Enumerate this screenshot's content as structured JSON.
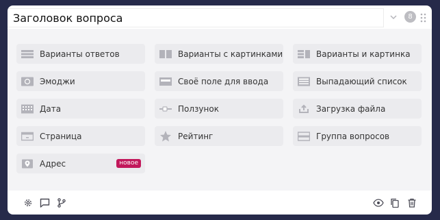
{
  "header": {
    "title": "Заголовок вопроса",
    "badge": "8"
  },
  "tiles": [
    {
      "label": "Варианты ответов",
      "icon": "list-icon"
    },
    {
      "label": "Варианты с картинками",
      "icon": "image-choices-icon"
    },
    {
      "label": "Варианты и картинка",
      "icon": "choices-and-image-icon"
    },
    {
      "label": "Эмоджи",
      "icon": "emoji-icon"
    },
    {
      "label": "Своё поле для ввода",
      "icon": "text-field-icon"
    },
    {
      "label": "Выпадающий список",
      "icon": "dropdown-list-icon"
    },
    {
      "label": "Дата",
      "icon": "calendar-icon"
    },
    {
      "label": "Ползунок",
      "icon": "slider-icon"
    },
    {
      "label": "Загрузка файла",
      "icon": "upload-icon"
    },
    {
      "label": "Страница",
      "icon": "page-icon"
    },
    {
      "label": "Рейтинг",
      "icon": "star-icon"
    },
    {
      "label": "Группа вопросов",
      "icon": "question-group-icon"
    },
    {
      "label": "Адрес",
      "icon": "location-icon",
      "badge": "новое"
    }
  ],
  "footer": {
    "left_icons": [
      "settings-icon",
      "comment-icon",
      "branch-icon"
    ],
    "right_icons": [
      "visibility-icon",
      "copy-icon",
      "delete-icon"
    ]
  },
  "colors": {
    "page_background": "#262a4a",
    "tile_background": "#ebebee",
    "icon_gray": "#a9a9b0",
    "new_badge": "#c2185b"
  }
}
